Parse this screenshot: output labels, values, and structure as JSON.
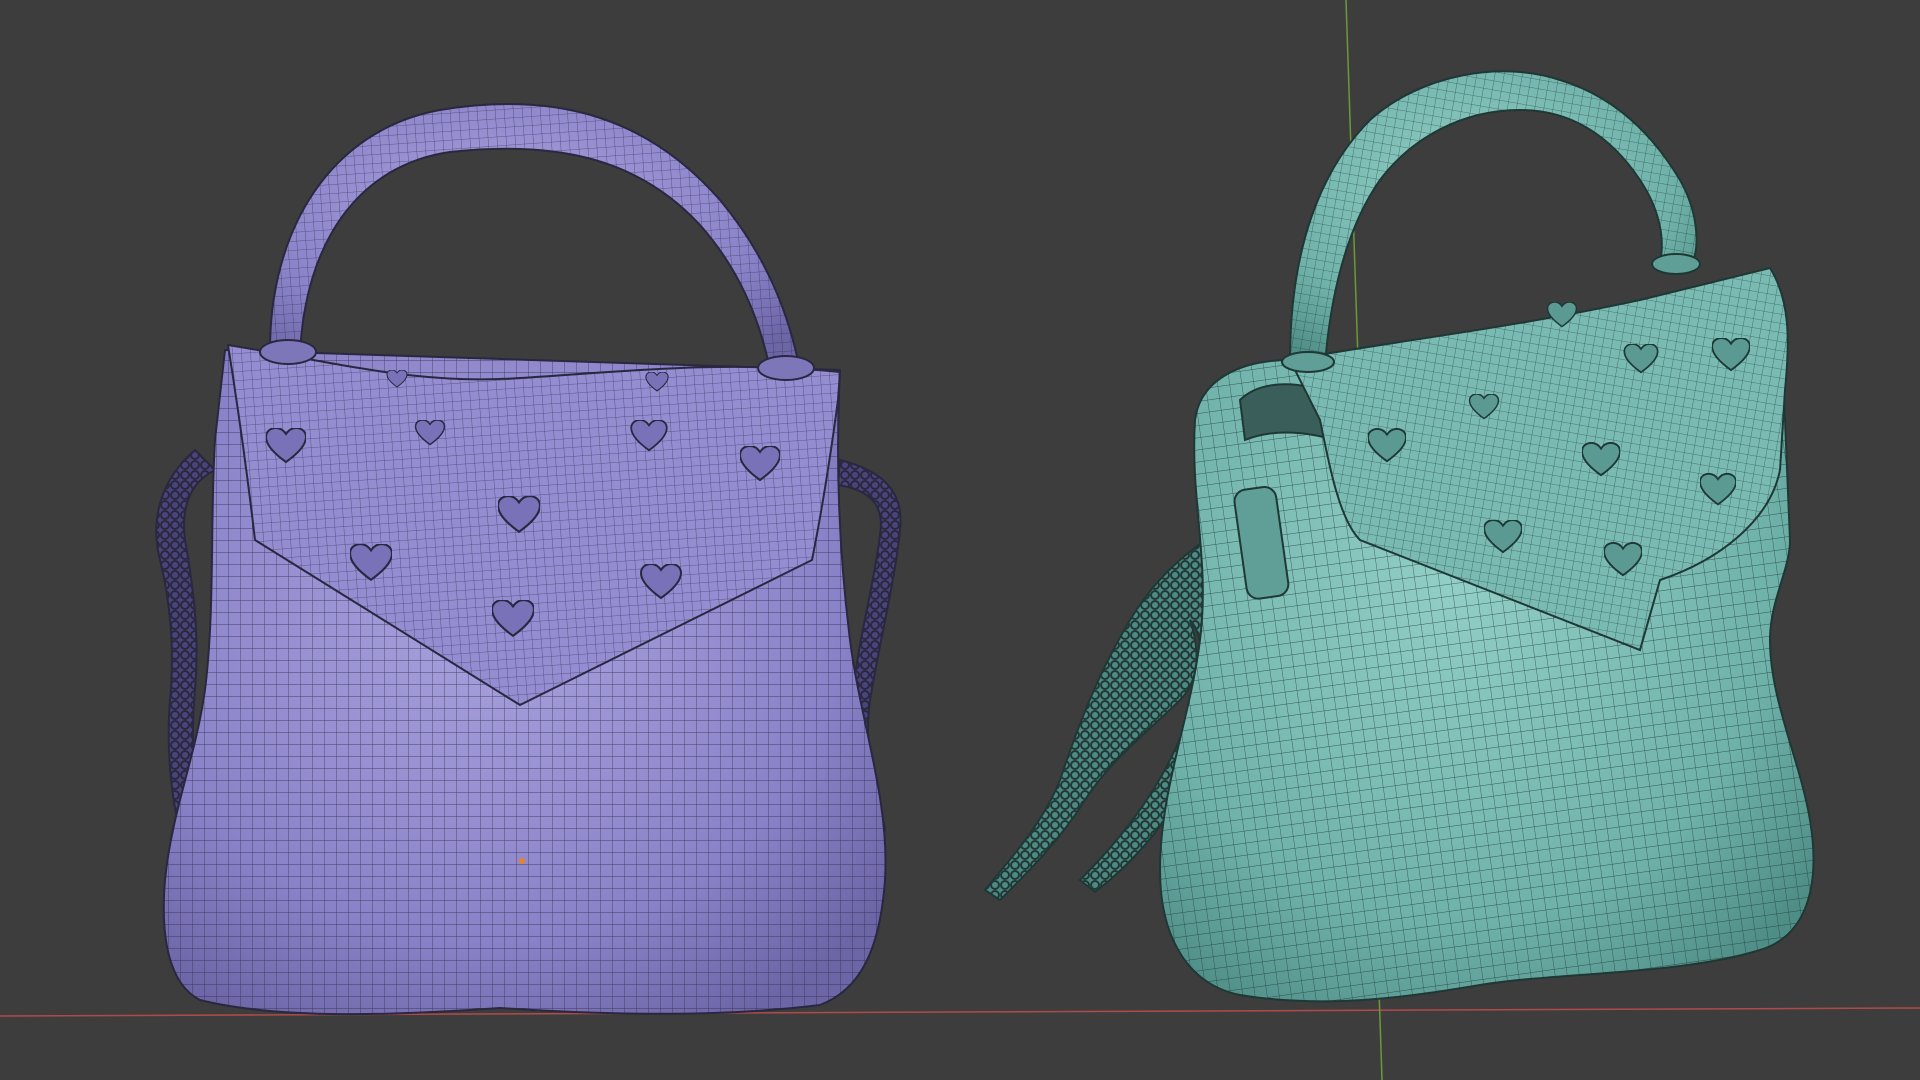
{
  "viewport": {
    "background": "#3d3d3d",
    "x_axis_color": "#b04a4a",
    "y_axis_color": "#6a9a3a",
    "origin_marker_color": "#e8822a"
  },
  "models": [
    {
      "name": "handbag-front-view",
      "fill": "#8a82c8",
      "fill_light": "#a9a2de",
      "wire": "#2a2740",
      "emblem": "heart-icon"
    },
    {
      "name": "handbag-three-quarter-view",
      "fill": "#6fb2aa",
      "fill_light": "#8fcac2",
      "wire": "#1f3835",
      "emblem": "heart-icon"
    }
  ]
}
